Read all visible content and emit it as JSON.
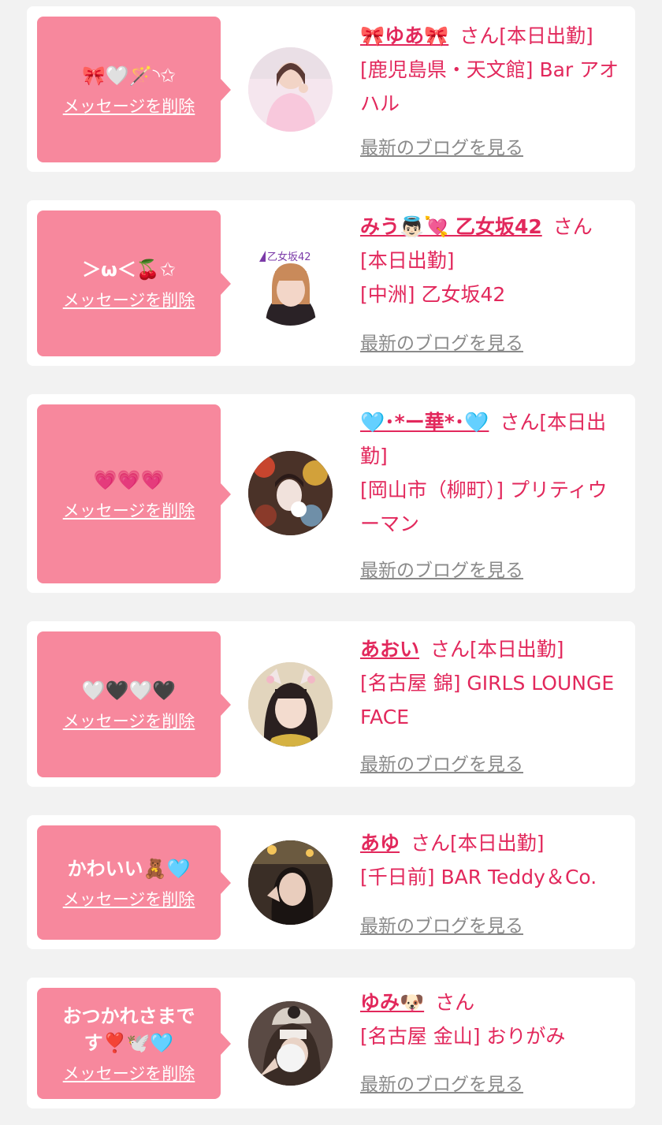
{
  "cards": [
    {
      "message": "🎀🤍🪄◝✩",
      "delete_label": "メッセージを削除",
      "name": "🎀ゆあ🎀",
      "honorific": "さん",
      "status": "[本日出勤]",
      "location": "[鹿児島県・天文館] Bar アオハル",
      "blog_label": "最新のブログを見る",
      "avatar_icon": "avatar-photo"
    },
    {
      "message": "＞ω＜🍒✩",
      "delete_label": "メッセージを削除",
      "name": "みう👼🏻💘 乙女坂42",
      "honorific": "さん",
      "status": "[本日出勤]",
      "location": "[中洲] 乙女坂42",
      "blog_label": "最新のブログを見る",
      "avatar_icon": "avatar-photo",
      "avatar_logo_text": "乙女坂42"
    },
    {
      "message": "💗💗💗",
      "delete_label": "メッセージを削除",
      "name": "🩵･*ー華*･🩵",
      "honorific": "さん",
      "status": "[本日出勤]",
      "location": "[岡山市（柳町）] プリティウーマン",
      "blog_label": "最新のブログを見る",
      "avatar_icon": "avatar-photo"
    },
    {
      "message": "🤍🖤🤍🖤",
      "delete_label": "メッセージを削除",
      "name": "あおい",
      "honorific": "さん",
      "status": "[本日出勤]",
      "location": "[名古屋 錦] GIRLS LOUNGE FACE",
      "blog_label": "最新のブログを見る",
      "avatar_icon": "avatar-photo"
    },
    {
      "message": "かわいい🧸🩵",
      "delete_label": "メッセージを削除",
      "name": "あゆ",
      "honorific": "さん",
      "status": "[本日出勤]",
      "location": "[千日前] BAR Teddy＆Co.",
      "blog_label": "最新のブログを見る",
      "avatar_icon": "avatar-photo"
    },
    {
      "message": "おつかれさまです❣️🕊️🩵",
      "delete_label": "メッセージを削除",
      "name": "ゆみ🐶",
      "honorific": "さん",
      "status": "",
      "location": "[名古屋 金山] おりがみ",
      "blog_label": "最新のブログを見る",
      "avatar_icon": "avatar-photo"
    }
  ],
  "colors": {
    "bubble": "#f7889d",
    "accent": "#e2285c",
    "link_gray": "#8a8a8a",
    "background": "#f2f2f2"
  }
}
